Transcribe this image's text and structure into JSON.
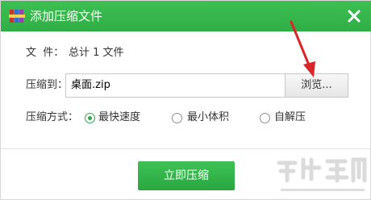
{
  "window": {
    "title": "添加压缩文件",
    "close_icon": "close-icon",
    "app_icon": "winrar-books-icon"
  },
  "files": {
    "label": "文  件：",
    "summary": "总计 1 文件"
  },
  "compress_to": {
    "label": "压缩到：",
    "value": "桌面.zip",
    "browse_label": "浏览..."
  },
  "method": {
    "label": "压缩方式：",
    "options": [
      {
        "label": "最快速度",
        "selected": true
      },
      {
        "label": "最小体积",
        "selected": false
      },
      {
        "label": "自解压",
        "selected": false
      }
    ]
  },
  "action": {
    "compress_label": "立即压缩"
  },
  "colors": {
    "titlebar": "#2fae45",
    "annotation_arrow": "#d9262b"
  }
}
